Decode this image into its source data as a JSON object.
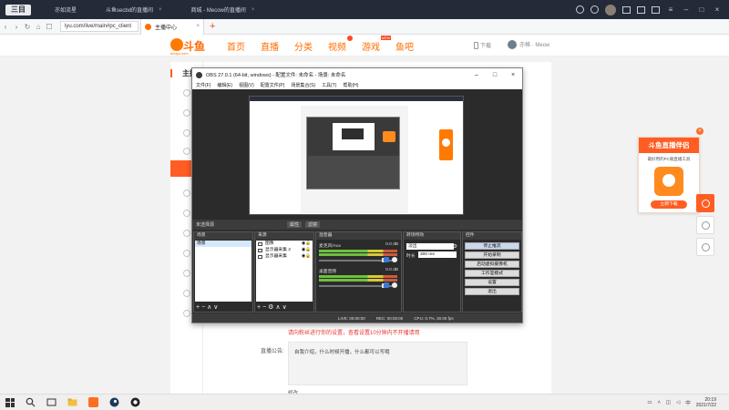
{
  "browser": {
    "tabs": [
      {
        "label": "亦如流星"
      },
      {
        "label": "斗鱼secbd的直播间"
      },
      {
        "label": "商城 - Mecow的直播间"
      }
    ],
    "url": "lyu.com/live/main#pc_client",
    "active_tab": "主播中心"
  },
  "douyu": {
    "logo_text": "斗鱼",
    "logo_sub": "douyu.com",
    "nav": [
      "首页",
      "直播",
      "分类",
      "视频",
      "游戏",
      "鱼吧"
    ],
    "download": "下载",
    "username": "亦格 · Meow"
  },
  "sidebar": {
    "title": "主播"
  },
  "obs": {
    "title": "OBS 27.0.1 (64-bit, windows) - 配置文件: 未命名 - 场景: 未命名",
    "menu": [
      "文件(F)",
      "编辑(E)",
      "视图(V)",
      "配置文件(P)",
      "场景集合(S)",
      "工具(T)",
      "帮助(H)"
    ],
    "source_bar": "未选择源",
    "source_bar_buttons": [
      "属性",
      "滤镜"
    ],
    "docks": {
      "scenes": {
        "title": "场景",
        "items": [
          "场景"
        ]
      },
      "sources": {
        "title": "来源",
        "items": [
          "图像",
          "显示器采集 2",
          "显示器采集"
        ]
      },
      "mixer": {
        "title": "混音器",
        "channels": [
          {
            "name": "麦克风/Aux",
            "db": "0.0 dB"
          },
          {
            "name": "桌面音频",
            "db": "0.0 dB"
          }
        ]
      },
      "transitions": {
        "title": "转场特效",
        "selected": "淡出",
        "duration_label": "时长",
        "duration": "300 ms"
      },
      "controls": {
        "title": "控件",
        "buttons": [
          "停止推流",
          "开始录制",
          "启动虚拟摄像机",
          "工作室模式",
          "设置",
          "退出"
        ]
      }
    },
    "status": {
      "live": "LIVE: 00:00:00",
      "rec": "REC: 00:00:00",
      "cpu": "CPU: 0.7%, 30.00 fps"
    }
  },
  "page": {
    "red_tip": "请向粉丝进行你的设置，查看设置10分钟内不开播请用",
    "notice_label": "直播公告:",
    "notice_placeholder": "自我介绍，什么时候开播，什么都可以写哦",
    "bottom_tab": "修改"
  },
  "promo": {
    "title": "斗鱼直播伴侣",
    "subtitle": "最好用的PC端直播工具",
    "button": "立即下载"
  },
  "taskbar": {
    "time": "20:19",
    "date": "2021/7/22"
  }
}
